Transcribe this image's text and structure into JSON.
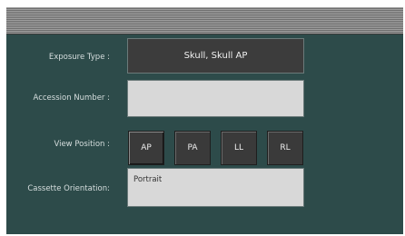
{
  "form": {
    "exposure_type_label": "Exposure Type :",
    "exposure_type_value": "Skull, Skull AP",
    "accession_number_label": "Accession Number :",
    "accession_number_value": "",
    "view_position_label": "View Position :",
    "view_positions": [
      "AP",
      "PA",
      "LL",
      "RL"
    ],
    "selected_view_position": "AP",
    "cassette_orientation_label": "Cassette Orientation:",
    "cassette_orientation_value": "Portrait"
  }
}
